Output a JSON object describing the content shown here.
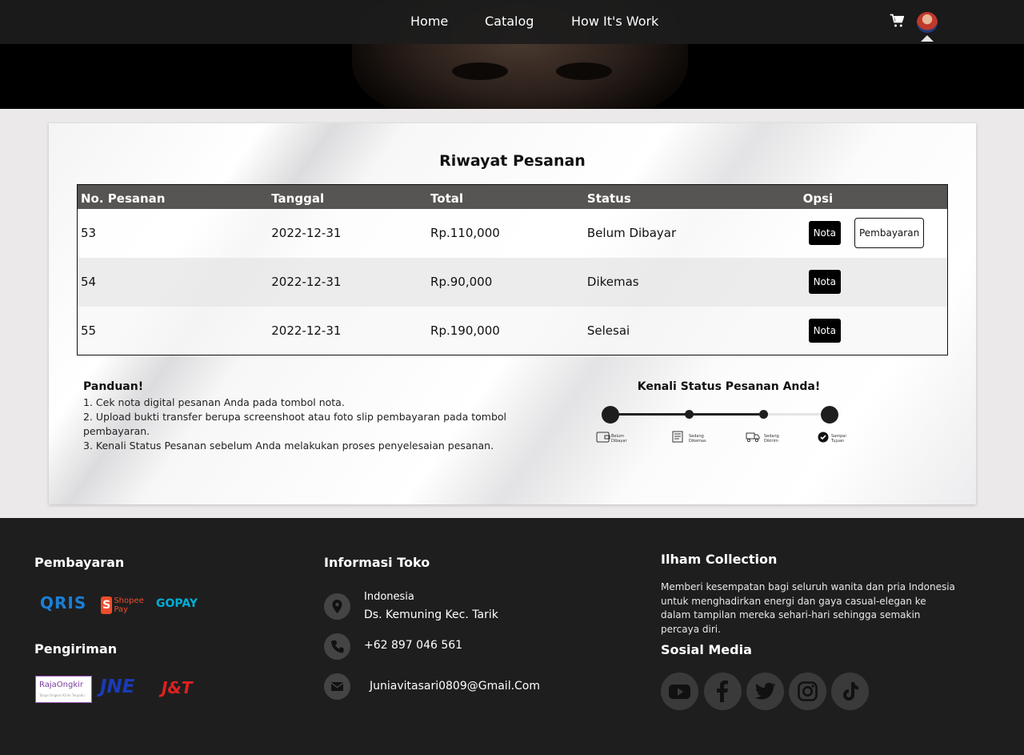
{
  "nav": {
    "home": "Home",
    "catalog": "Catalog",
    "how": "How It's Work"
  },
  "card": {
    "title": "Riwayat Pesanan",
    "columns": [
      "No. Pesanan",
      "Tanggal",
      "Total",
      "Status",
      "Opsi"
    ],
    "rows": [
      {
        "id": "53",
        "date": "2022-12-31",
        "total": "Rp.110,000",
        "status": "Belum Dibayar",
        "nota": "Nota",
        "pay": "Pembayaran"
      },
      {
        "id": "54",
        "date": "2022-12-31",
        "total": "Rp.90,000",
        "status": "Dikemas",
        "nota": "Nota"
      },
      {
        "id": "55",
        "date": "2022-12-31",
        "total": "Rp.190,000",
        "status": "Selesai",
        "nota": "Nota"
      }
    ],
    "guide": {
      "title": "Panduan!",
      "lines": [
        "1. Cek nota digital pesanan Anda pada tombol nota.",
        "2. Upload bukti transfer berupa screenshoot atau foto slip pembayaran pada tombol pembayaran.",
        "3. Kenali Status Pesanan sebelum Anda melakukan proses penyelesaian pesanan."
      ]
    },
    "status_guide": {
      "title": "Kenali Status Pesanan Anda!",
      "steps": [
        "Belum Dibayar",
        "Sedang Dikemas",
        "Sedang Dikirim",
        "Sampai Tujuan"
      ]
    }
  },
  "footer": {
    "payment_title": "Pembayaran",
    "payment_logos": [
      "QRIS",
      "Shopee Pay",
      "GOPAY"
    ],
    "shipping_title": "Pengiriman",
    "shipping_logos": [
      "RajaOngkir",
      "JNE",
      "J&T"
    ],
    "rajaongkir_tagline": "Tanpa Ongkos Kirim Terpadu",
    "store_title": "Informasi Toko",
    "country": "Indonesia",
    "address": "Ds. Kemuning Kec. Tarik",
    "phone": "+62 897 046 561",
    "email": "Juniavitasari0809@Gmail.Com",
    "brand_title": "Ilham Collection",
    "brand_desc": "Memberi kesempatan bagi seluruh wanita dan pria Indonesia untuk menghadirkan energi dan gaya casual-elegan ke dalam tampilan mereka sehari-hari sehingga semakin percaya diri.",
    "social_title": "Sosial Media",
    "socials": [
      "youtube-icon",
      "facebook-icon",
      "twitter-icon",
      "instagram-icon",
      "tiktok-icon"
    ]
  }
}
